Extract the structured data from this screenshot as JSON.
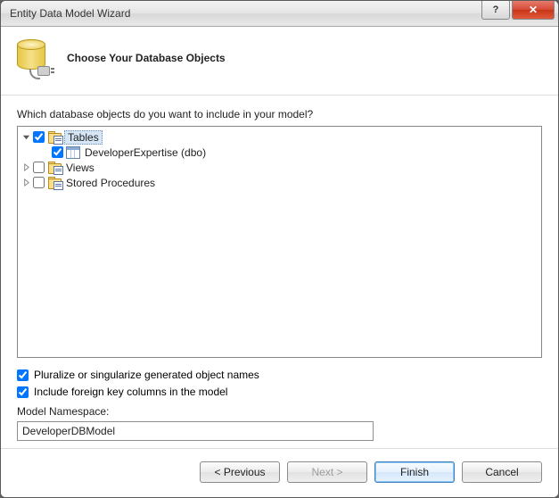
{
  "window": {
    "title": "Entity Data Model Wizard"
  },
  "header": {
    "title": "Choose Your Database Objects"
  },
  "body": {
    "prompt": "Which database objects do you want to include in your model?",
    "tree": {
      "tables": {
        "label": "Tables",
        "checked": true,
        "expanded": true,
        "selected": true
      },
      "children": [
        {
          "label": "DeveloperExpertise (dbo)",
          "checked": true
        }
      ],
      "views": {
        "label": "Views",
        "checked": false,
        "expanded": false
      },
      "stored_procs": {
        "label": "Stored Procedures",
        "checked": false,
        "expanded": false
      }
    },
    "options": {
      "pluralize": {
        "label": "Pluralize or singularize generated object names",
        "checked": true
      },
      "fk": {
        "label": "Include foreign key columns in the model",
        "checked": true
      }
    },
    "namespace": {
      "label": "Model Namespace:",
      "value": "DeveloperDBModel"
    }
  },
  "footer": {
    "previous": "< Previous",
    "next": "Next >",
    "finish": "Finish",
    "cancel": "Cancel"
  }
}
